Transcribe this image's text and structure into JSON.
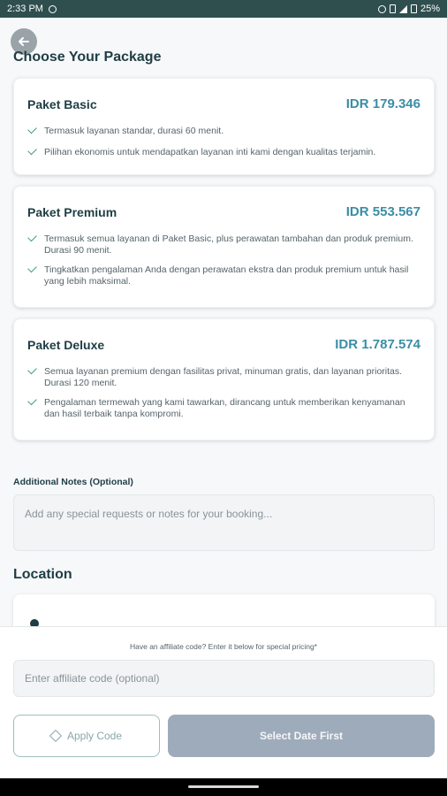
{
  "status": {
    "time": "2:33 PM",
    "battery": "25%"
  },
  "header": {
    "title": "Choose Your Package"
  },
  "packages": [
    {
      "name": "Paket Basic",
      "price": "IDR 179.346",
      "features": [
        "Termasuk layanan standar, durasi 60 menit.",
        "Pilihan ekonomis untuk mendapatkan layanan inti kami dengan kualitas terjamin."
      ]
    },
    {
      "name": "Paket Premium",
      "price": "IDR 553.567",
      "features": [
        "Termasuk semua layanan di Paket Basic, plus perawatan tambahan dan produk premium. Durasi 90 menit.",
        "Tingkatkan pengalaman Anda dengan perawatan ekstra dan produk premium untuk hasil yang lebih maksimal."
      ]
    },
    {
      "name": "Paket Deluxe",
      "price": "IDR 1.787.574",
      "features": [
        "Semua layanan premium dengan fasilitas privat, minuman gratis, dan layanan prioritas. Durasi 120 menit.",
        "Pengalaman termewah yang kami tawarkan, dirancang untuk memberikan kenyamanan dan hasil terbaik tanpa kompromi."
      ]
    }
  ],
  "notes": {
    "label": "Additional Notes (Optional)",
    "placeholder": "Add any special requests or notes for your booking..."
  },
  "location": {
    "title": "Location"
  },
  "affiliate": {
    "hint": "Have an affiliate code? Enter it below for special pricing*",
    "placeholder": "Enter affiliate code (optional)",
    "apply_label": "Apply Code"
  },
  "actions": {
    "date_label": "Select Date First"
  },
  "icons": {
    "back": "arrow-left-icon",
    "check": "check-icon",
    "tag": "tag-icon",
    "pin": "location-pin-icon"
  },
  "colors": {
    "accent": "#3a8ea6",
    "heading": "#1e3d45",
    "status_bar": "#2f4f4f",
    "disabled_button": "#9eabbb"
  }
}
